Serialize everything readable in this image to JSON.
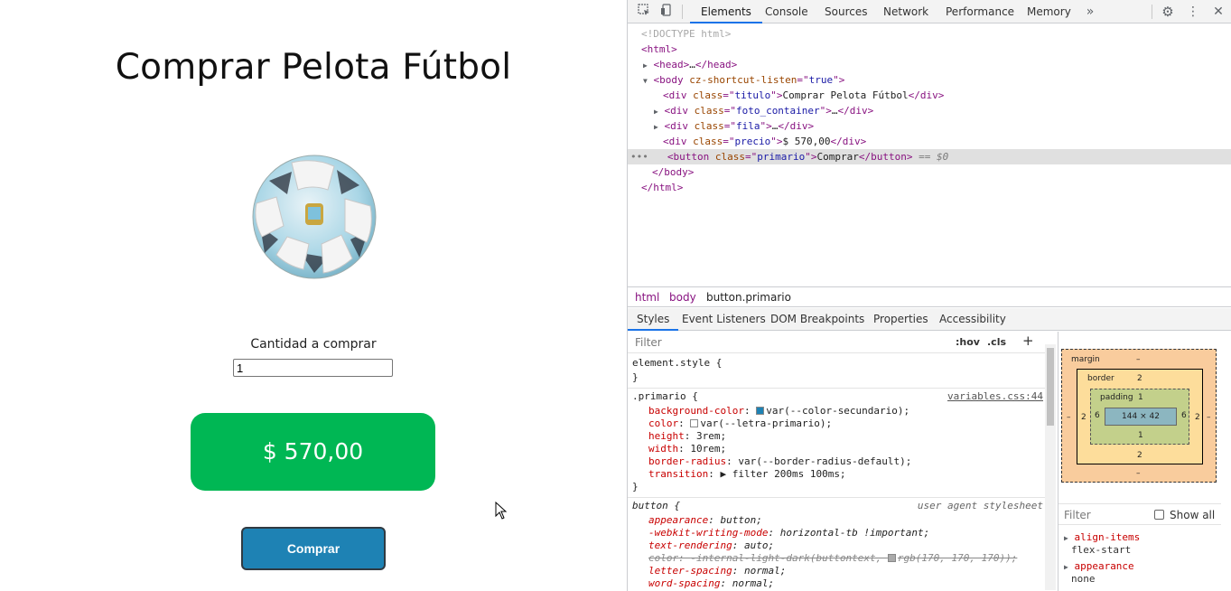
{
  "page": {
    "title": "Comprar Pelota Fútbol",
    "quantity_label": "Cantidad a comprar",
    "quantity_value": "1",
    "price": "$ 570,00",
    "buy_button": "Comprar",
    "colors": {
      "price_bg": "#00b754",
      "button_bg": "#1e82b4"
    }
  },
  "devtools": {
    "tabs": [
      "Elements",
      "Console",
      "Sources",
      "Network",
      "Performance",
      "Memory"
    ],
    "active_tab": "Elements",
    "more_tabs_icon": "chevrons-right-icon",
    "dom": {
      "doctype": "<!DOCTYPE html>",
      "html_open": "html",
      "head": "head",
      "head_ellipsis": "…",
      "body_tag": "body",
      "body_attr": "cz-shortcut-listen",
      "body_attr_val": "true",
      "titulo_class": "titulo",
      "titulo_text": "Comprar Pelota Fútbol",
      "foto_class": "foto_container",
      "fila_class": "fila",
      "precio_class": "precio",
      "precio_text": "$ 570,00",
      "button_tag": "button",
      "button_class": "primario",
      "button_text": "Comprar",
      "selected_marker": "== $0",
      "ellipsis": "…",
      "gutter_dots": "•••"
    },
    "breadcrumbs": [
      "html",
      "body",
      "button.primario"
    ],
    "subtabs": [
      "Styles",
      "Event Listeners",
      "DOM Breakpoints",
      "Properties",
      "Accessibility"
    ],
    "styles": {
      "filter_placeholder": "Filter",
      "hov": ":hov",
      "cls": ".cls",
      "plus": "+",
      "element_style": "element.style {",
      "close_brace": "}",
      "primario_selector": ".primario {",
      "primario_source": "variables.css:44",
      "primario_rules": [
        {
          "prop": "background-color",
          "value": "var(--color-secundario);",
          "swatch": "#1e82b4"
        },
        {
          "prop": "color",
          "value": "var(--letra-primario);",
          "swatch": "#ffffff"
        },
        {
          "prop": "height",
          "value": "3rem;"
        },
        {
          "prop": "width",
          "value": "10rem;"
        },
        {
          "prop": "border-radius",
          "value": "var(--border-radius-default);"
        },
        {
          "prop": "transition",
          "value": "▶ filter 200ms 100ms;"
        }
      ],
      "button_selector": "button {",
      "ua_source": "user agent stylesheet",
      "button_rules": [
        {
          "prop": "appearance",
          "value": "button;"
        },
        {
          "prop": "-webkit-writing-mode",
          "value": "horizontal-tb !important;"
        },
        {
          "prop": "text-rendering",
          "value": "auto;"
        },
        {
          "prop": "color",
          "value": "-internal-light-dark(buttontext, ",
          "value2": "rgb(170, 170, 170));",
          "struck": true,
          "swatch": "#aaaaaa"
        },
        {
          "prop": "letter-spacing",
          "value": "normal;"
        },
        {
          "prop": "word-spacing",
          "value": "normal;"
        }
      ]
    },
    "box_model": {
      "margin_label": "margin",
      "margin_value": "–",
      "border_label": "border",
      "border_value": "2",
      "padding_label": "padding",
      "padding_value": "1",
      "content": "144 × 42",
      "side_margin": "–",
      "side_border": "2",
      "side_padding": "6",
      "bottom_padding": "1",
      "bottom_border": "2",
      "bottom_margin": "–"
    },
    "computed": {
      "filter_placeholder": "Filter",
      "show_all": "Show all",
      "props": [
        {
          "name": "align-items",
          "value": "flex-start"
        },
        {
          "name": "appearance",
          "value": "none"
        }
      ]
    }
  }
}
